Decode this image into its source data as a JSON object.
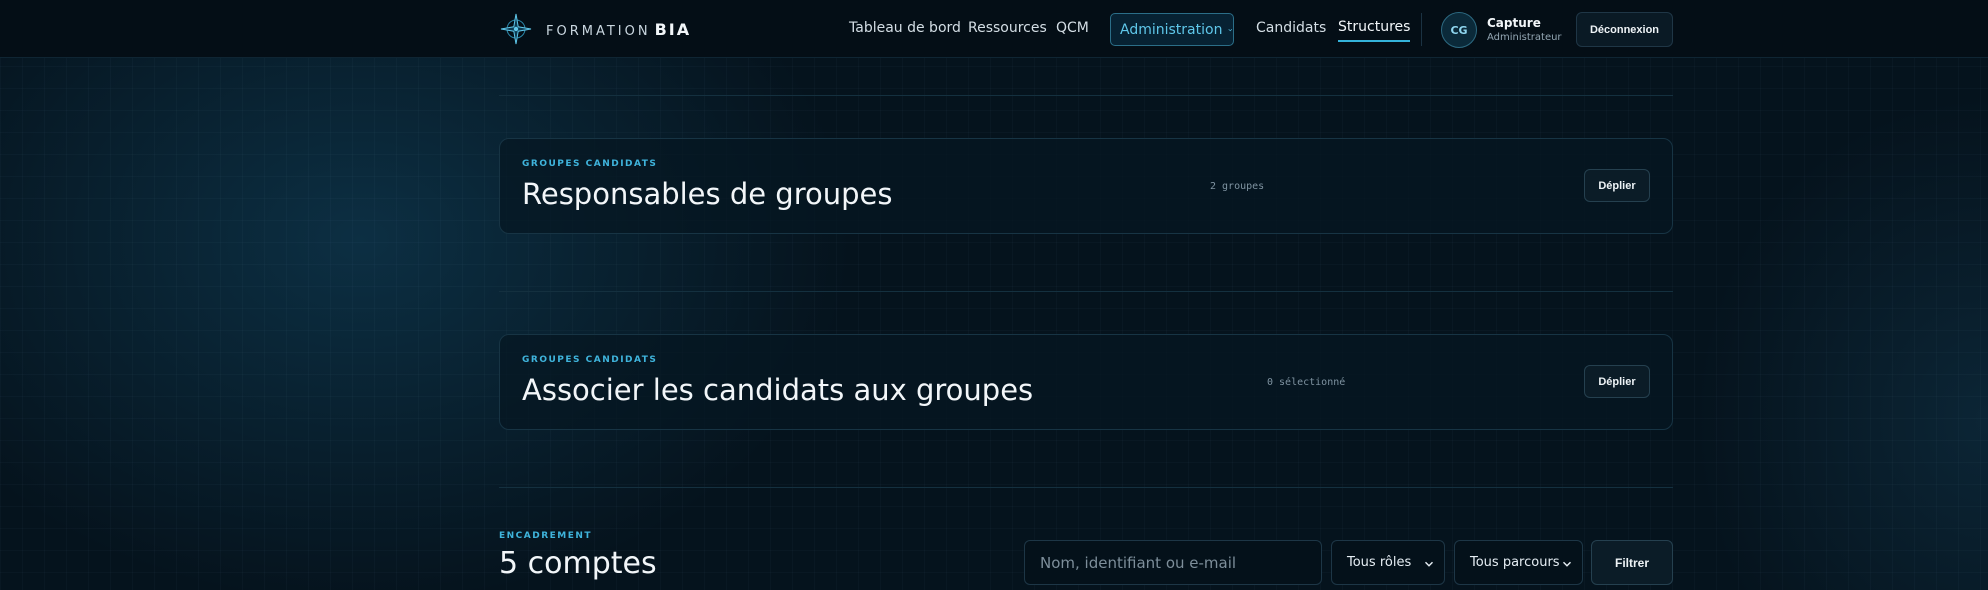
{
  "brand": {
    "prefix": "FORMATION",
    "name": "BIA"
  },
  "nav": {
    "items": [
      {
        "label": "Tableau de bord"
      },
      {
        "label": "Ressources"
      },
      {
        "label": "QCM"
      },
      {
        "label": "Administration"
      },
      {
        "label": "Candidats"
      },
      {
        "label": "Structures"
      }
    ]
  },
  "user": {
    "initials": "CG",
    "name": "Capture",
    "role": "Administrateur"
  },
  "logout_label": "Déconnexion",
  "cards": [
    {
      "eyebrow": "GROUPES CANDIDATS",
      "title": "Responsables de groupes",
      "meta": "2 groupes",
      "button": "Déplier"
    },
    {
      "eyebrow": "GROUPES CANDIDATS",
      "title": "Associer les candidats aux groupes",
      "meta": "0 sélectionné",
      "button": "Déplier"
    }
  ],
  "section": {
    "eyebrow": "ENCADREMENT",
    "title": "5 comptes",
    "search": {
      "placeholder": "Nom, identifiant ou e-mail",
      "value": ""
    },
    "role_filter": "Tous rôles",
    "path_filter": "Tous parcours",
    "filter_button": "Filtrer"
  },
  "colors": {
    "accent": "#34b3db",
    "background": "#05131d"
  },
  "icons": {
    "brand": "compass-star-icon",
    "dropdown": "chevron-down-icon"
  }
}
